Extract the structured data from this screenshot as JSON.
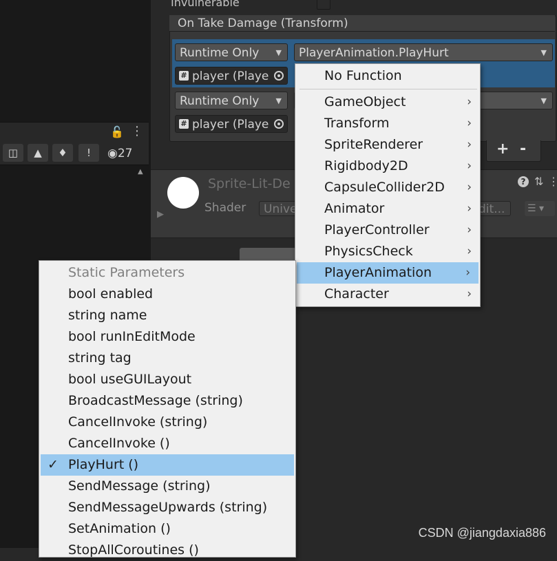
{
  "inspector": {
    "invulnerable_label": "Invulnerable",
    "event_title": "On Take Damage (Transform)",
    "rows": [
      {
        "mode": "Runtime Only",
        "function": "PlayerAnimation.PlayHurt",
        "object": "player (Playe"
      },
      {
        "mode": "Runtime Only",
        "object": "player (Playe"
      }
    ],
    "add_label": "+",
    "remove_label": "-",
    "material_name": "Sprite-Lit-De",
    "shader_label": "Shader",
    "shader_value": "Unive",
    "edit_label": "dit...",
    "hidden_count": "27"
  },
  "component_menu": {
    "no_function": "No Function",
    "items": [
      "GameObject",
      "Transform",
      "SpriteRenderer",
      "Rigidbody2D",
      "CapsuleCollider2D",
      "Animator",
      "PlayerController",
      "PhysicsCheck",
      "PlayerAnimation",
      "Character"
    ],
    "highlighted": "PlayerAnimation"
  },
  "method_menu": {
    "header": "Static Parameters",
    "items": [
      "bool enabled",
      "string name",
      "bool runInEditMode",
      "string tag",
      "bool useGUILayout",
      "BroadcastMessage (string)",
      "CancelInvoke (string)",
      "CancelInvoke ()",
      "PlayHurt ()",
      "SendMessage (string)",
      "SendMessageUpwards (string)",
      "SetAnimation ()",
      "StopAllCoroutines ()"
    ],
    "selected": "PlayHurt ()"
  },
  "watermark": "CSDN @jiangdaxia886"
}
